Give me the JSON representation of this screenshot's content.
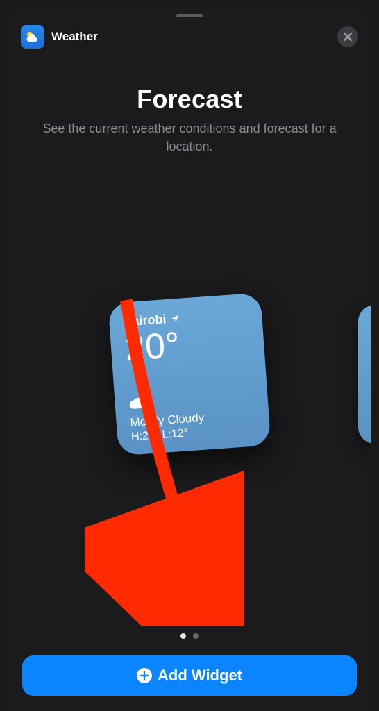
{
  "header": {
    "app_name": "Weather"
  },
  "title": "Forecast",
  "subtitle": "See the current weather conditions and forecast for a location.",
  "widget": {
    "location": "Nairobi",
    "temperature": "20°",
    "condition": "Mostly Cloudy",
    "high_low": "H:21° L:12°"
  },
  "button": {
    "add_label": "Add Widget"
  }
}
